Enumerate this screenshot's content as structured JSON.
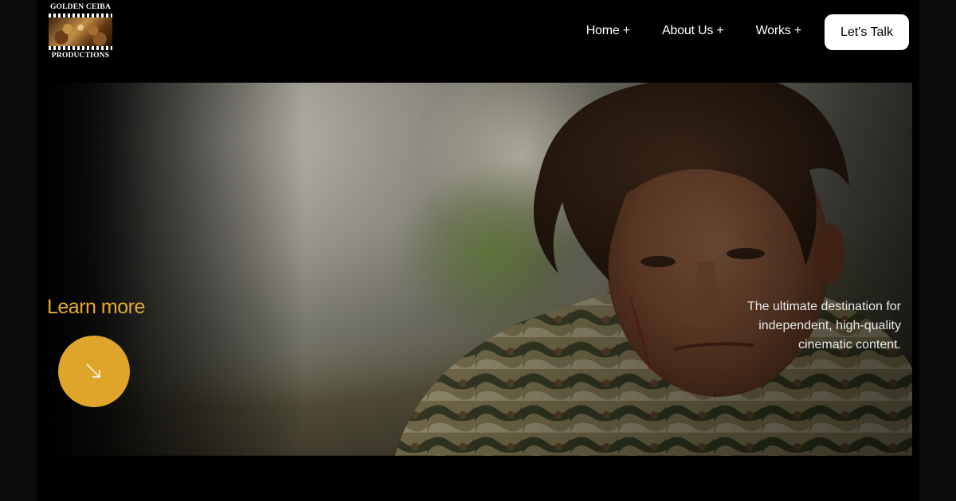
{
  "brand": {
    "line1": "GOLDEN CEIBA",
    "line2": "PRODUCTIONS",
    "logo_icon": "ceiba-tree-film-icon"
  },
  "nav": {
    "items": [
      {
        "label": "Home +"
      },
      {
        "label": "About Us +"
      },
      {
        "label": "Works +"
      }
    ],
    "cta_label": "Let's Talk"
  },
  "hero": {
    "heading": "Learn more",
    "arrow_icon": "arrow-down-right-icon",
    "tagline_lines": [
      "The ultimate destination for",
      "independent, high-quality",
      "cinematic content."
    ],
    "image_subject": "actor-portrait-photo"
  },
  "colors": {
    "accent": "#dfa52a",
    "heading": "#e6a92b",
    "background": "#000000",
    "cta_bg": "#ffffff"
  }
}
